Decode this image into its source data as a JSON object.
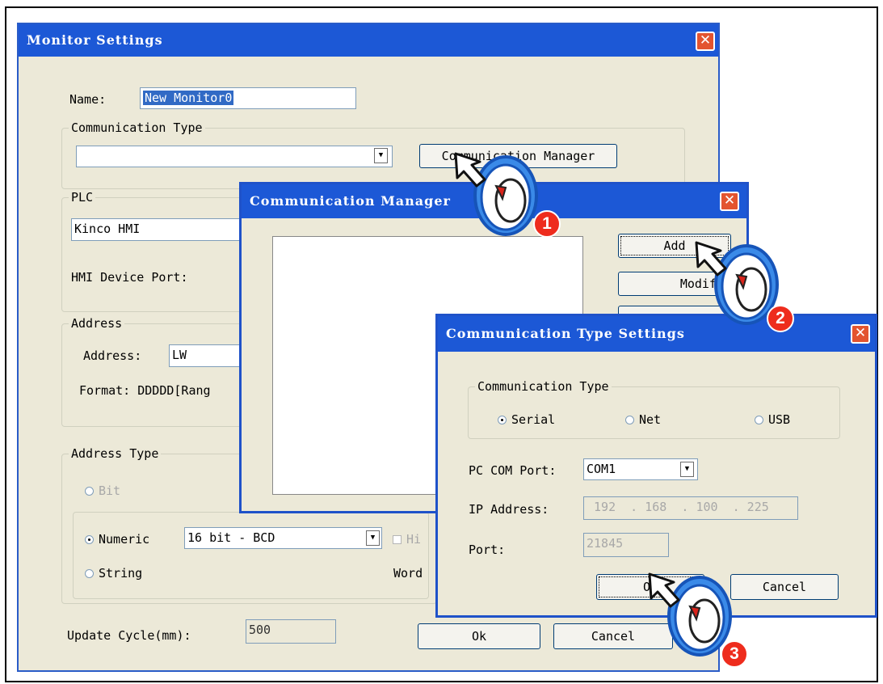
{
  "monitor_settings": {
    "title": "Monitor Settings",
    "name_label": "Name:",
    "name_value": "New Monitor0",
    "comm_type_group": "Communication Type",
    "comm_type_value": "",
    "comm_manager_button": "Communication Manager",
    "plc_group": "PLC",
    "plc_value": "Kinco HMI",
    "hmi_port_label": "HMI Device Port:",
    "address_group": "Address",
    "address_label": "Address:",
    "address_value": "LW",
    "format_label": "Format: DDDDD[Rang",
    "address_type_group": "Address Type",
    "bit_label": "Bit",
    "numeric_label": "Numeric",
    "numeric_format": "16 bit - BCD",
    "high_label": "Hi",
    "string_label": "String",
    "word_label": "Word",
    "update_cycle_label": "Update Cycle(mm):",
    "update_cycle_value": "500",
    "ok_button": "Ok",
    "cancel_button": "Cancel"
  },
  "communication_manager": {
    "title": "Communication Manager",
    "add_button": "Add",
    "modify_button": "Modify"
  },
  "communication_type_settings": {
    "title": "Communication Type Settings",
    "group_label": "Communication Type",
    "radio_serial": "Serial",
    "radio_net": "Net",
    "radio_usb": "USB",
    "selected": "Serial",
    "com_port_label": "PC COM Port:",
    "com_port_value": "COM1",
    "ip_label": "IP Address:",
    "ip_value": " 192  . 168  . 100  . 225",
    "port_label": "Port:",
    "port_value": "21845",
    "ok_button": "OK",
    "cancel_button": "Cancel"
  },
  "step_badges": [
    "1",
    "2",
    "3"
  ],
  "colors": {
    "titlebar": "#1c58d6",
    "dialog_bg": "#ece9d8",
    "badge": "#ee2c1d",
    "cursor_ring": "#2f7fe6"
  }
}
